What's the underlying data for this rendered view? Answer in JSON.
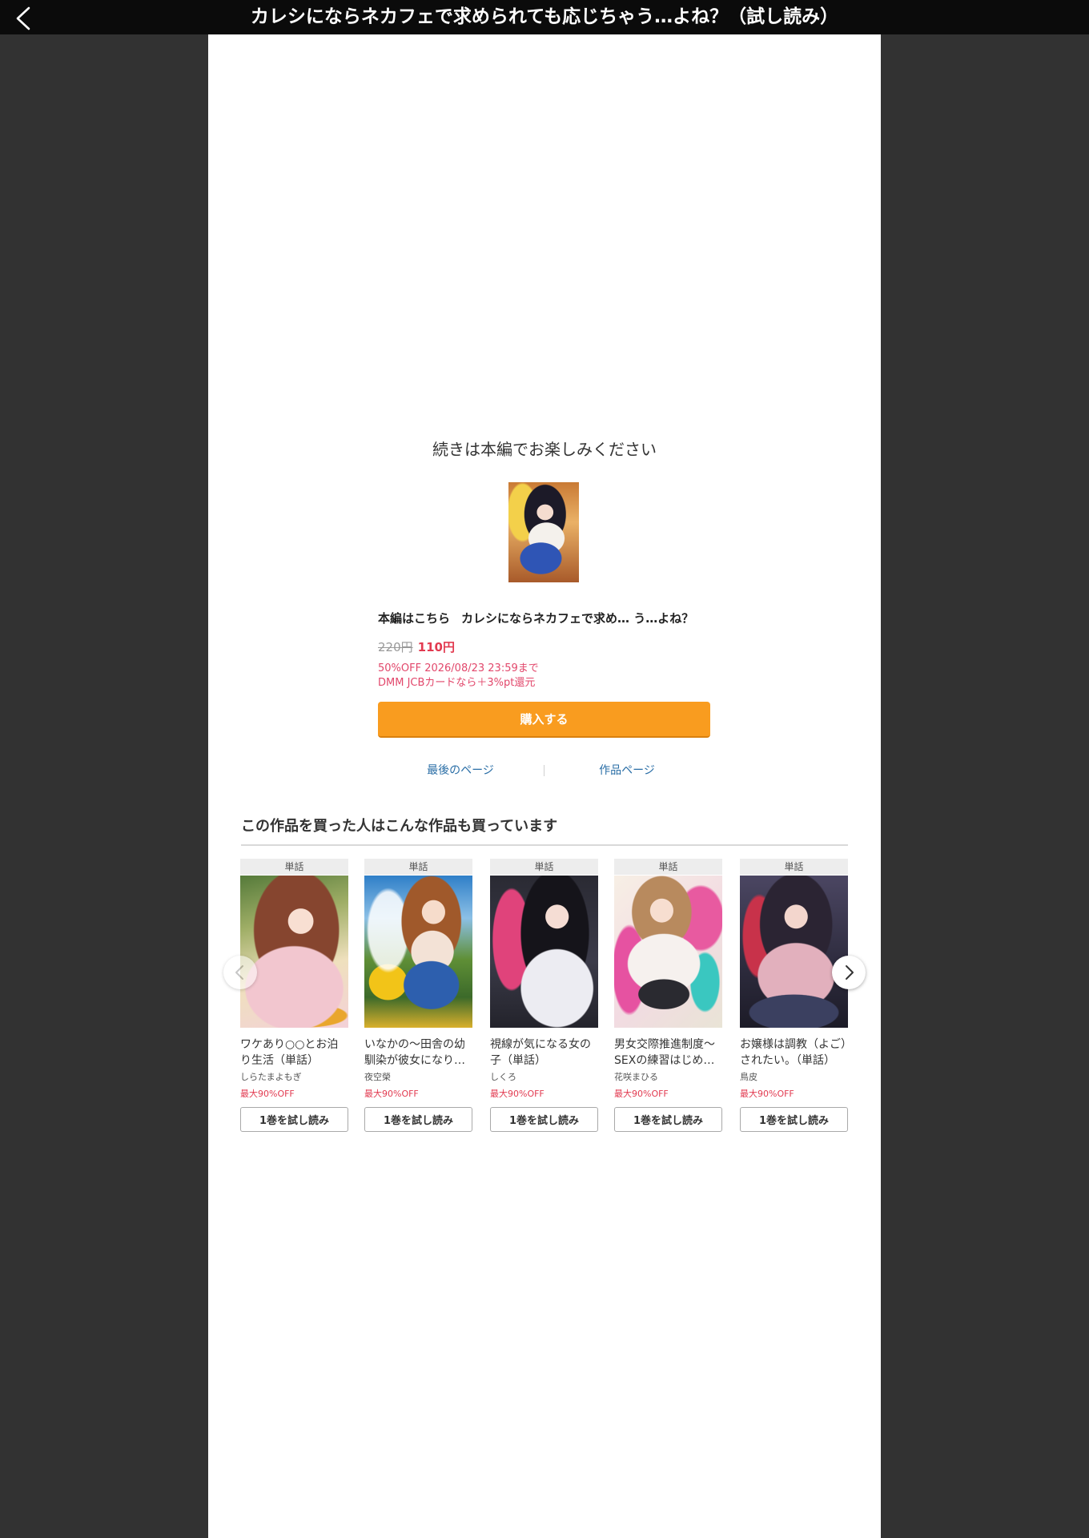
{
  "header": {
    "back_icon": "chevron-left-icon",
    "title": "カレシにならネカフェで求められても応じちゃう…よね？（試し読み）"
  },
  "end_screen": {
    "message": "続きは本編でお楽しみください",
    "product": {
      "label": "本編はこちら",
      "title": "カレシにならネカフェで求め… う…よね？",
      "list_price": "220円",
      "sale_price": "110円",
      "sale_note": "50%OFF 2026/08/23 23:59まで",
      "card_note": "DMM JCBカードなら＋3%pt還元",
      "buy_button": "購入する"
    },
    "links": {
      "last_page": "最後のページ",
      "work_page": "作品ページ"
    }
  },
  "recommendations": {
    "heading": "この作品を買った人はこんな作品も買っています",
    "prev_icon": "chevron-left-icon",
    "next_icon": "chevron-right-icon",
    "items": [
      {
        "tag": "単話",
        "title_lines": [
          "ワケあり○○とお泊",
          "り生活（単話）"
        ],
        "author": "しらたまよもぎ",
        "discount": "最大90%OFF",
        "button": "1巻を試し読み"
      },
      {
        "tag": "単話",
        "title_lines": [
          "いなかの～田舎の幼",
          "馴染が彼女になり…"
        ],
        "author": "夜空榮",
        "discount": "最大90%OFF",
        "button": "1巻を試し読み"
      },
      {
        "tag": "単話",
        "title_lines": [
          "視線が気になる女の",
          "子（単話）"
        ],
        "author": "しくろ",
        "discount": "最大90%OFF",
        "button": "1巻を試し読み"
      },
      {
        "tag": "単話",
        "title_lines": [
          "男女交際推進制度～",
          "SEXの練習はじめ…"
        ],
        "author": "花咲まひる",
        "discount": "最大90%OFF",
        "button": "1巻を試し読み"
      },
      {
        "tag": "単話",
        "title_lines": [
          "お嬢様は調教（よご）",
          "されたい。（単話）"
        ],
        "author": "鳥皮",
        "discount": "最大90%OFF",
        "button": "1巻を試し読み"
      }
    ]
  },
  "colors": {
    "background": "#323232",
    "header": "#0b0b0b",
    "panel": "#ffffff",
    "accent": "#f99c1f",
    "price": "#e23a50",
    "link": "#2a6ea6"
  }
}
